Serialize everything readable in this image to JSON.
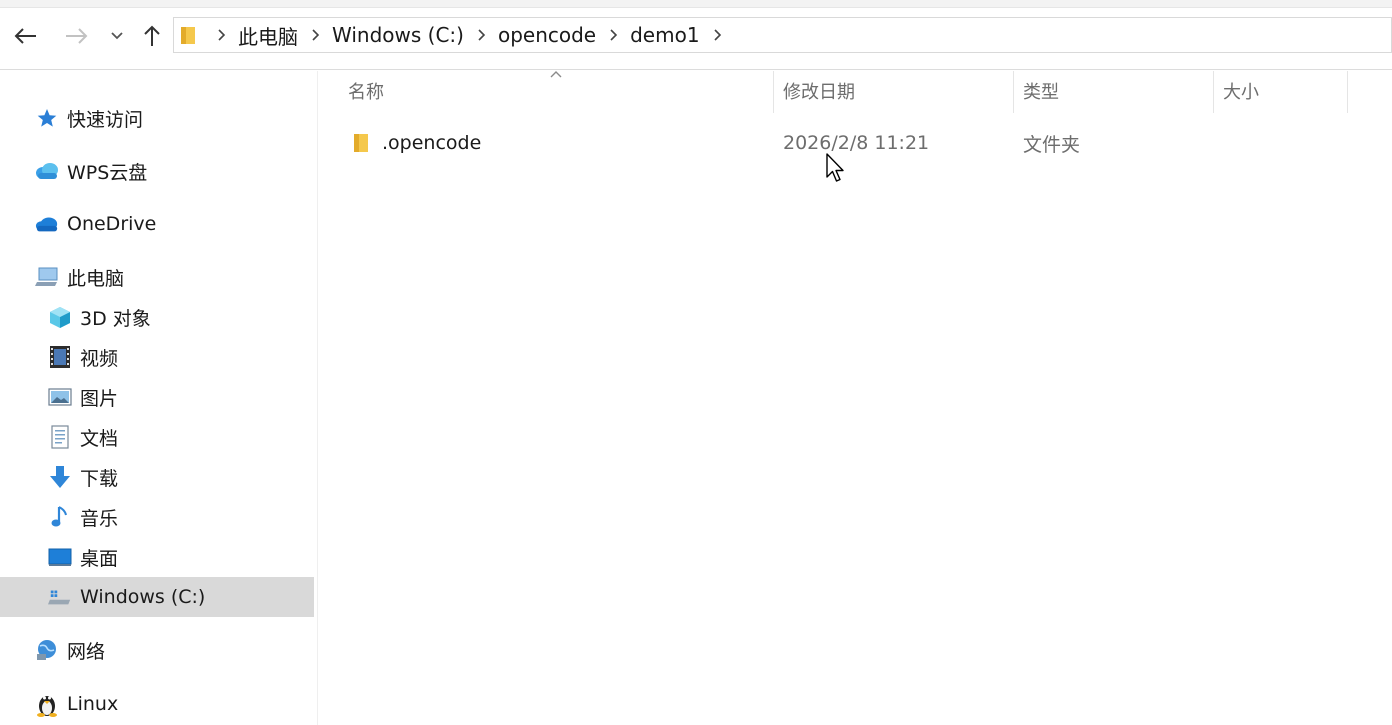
{
  "address": {
    "crumbs": [
      "此电脑",
      "Windows (C:)",
      "opencode",
      "demo1"
    ]
  },
  "sidebar": {
    "items": [
      {
        "label": "快速访问",
        "icon": "star-icon"
      },
      {
        "label": "WPS云盘",
        "icon": "wps-cloud-icon"
      },
      {
        "label": "OneDrive",
        "icon": "onedrive-cloud-icon"
      },
      {
        "label": "此电脑",
        "icon": "computer-icon"
      },
      {
        "label": "3D 对象",
        "icon": "3d-objects-icon"
      },
      {
        "label": "视频",
        "icon": "video-icon"
      },
      {
        "label": "图片",
        "icon": "pictures-icon"
      },
      {
        "label": "文档",
        "icon": "documents-icon"
      },
      {
        "label": "下载",
        "icon": "download-icon"
      },
      {
        "label": "音乐",
        "icon": "music-icon"
      },
      {
        "label": "桌面",
        "icon": "desktop-icon"
      },
      {
        "label": "Windows (C:)",
        "icon": "drive-icon",
        "selected": true
      },
      {
        "label": "网络",
        "icon": "network-icon"
      },
      {
        "label": "Linux",
        "icon": "linux-icon"
      }
    ]
  },
  "columns": {
    "name": "名称",
    "modified": "修改日期",
    "type": "类型",
    "size": "大小"
  },
  "files": [
    {
      "name": ".opencode",
      "modified": "2026/2/8 11:21",
      "type": "文件夹",
      "size": "",
      "icon": "folder-icon"
    }
  ],
  "colors": {
    "selected_bg": "#d9d9d9",
    "folder_yellow": "#f5c84c",
    "accent_blue": "#1e7fd8"
  }
}
